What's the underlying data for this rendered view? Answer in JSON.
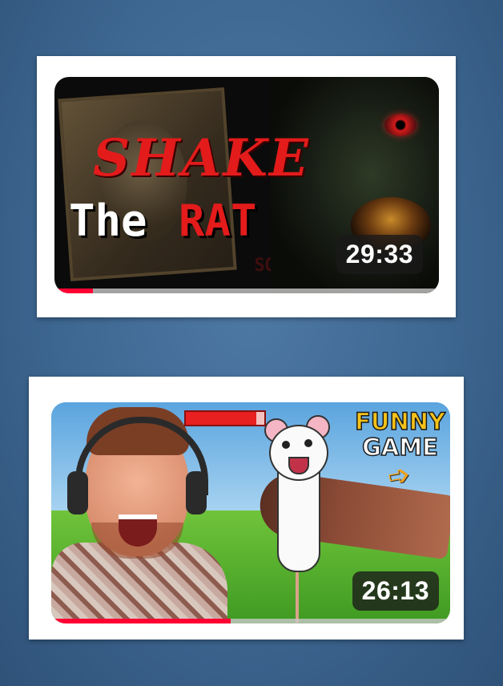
{
  "videos": [
    {
      "thumbnail": {
        "title_line1": "SHAKE",
        "title_line2_a": "The",
        "title_line2_b": "RAT",
        "background_words": "SQUEEZE",
        "colors": {
          "title_red": "#e31b1b",
          "title_white": "#ffffff",
          "background": "#0c0b0b"
        }
      },
      "duration": "29:33",
      "watched_progress": 0.1
    },
    {
      "thumbnail": {
        "badge_line1": "FUNNY",
        "badge_line2": "GAME",
        "health_bar_fill": 0.9,
        "colors": {
          "badge_yellow": "#f5c21a",
          "arrow": "#f5a21a",
          "sky": "#8dc3ec",
          "grass": "#4fae2c"
        }
      },
      "duration": "26:13",
      "watched_progress": 0.45
    }
  ],
  "progress_color": "#ff0033"
}
